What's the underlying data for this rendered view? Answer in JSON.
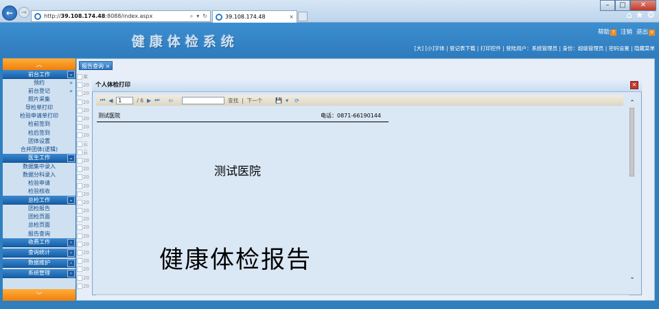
{
  "browser": {
    "url_prefix": "http://",
    "url_host": "39.108.174.48",
    "url_rest": ":8088/index.aspx",
    "tab_title": "39.108.174.48",
    "tab_close": "×",
    "back": "←",
    "forward": "→",
    "search_glyph": "⌕",
    "dropdown_glyph": "▾",
    "refresh_glyph": "↻",
    "home_glyph": "⌂",
    "star_glyph": "★",
    "gear_glyph": "⚙",
    "min": "–",
    "max": "□",
    "close": "✕"
  },
  "app": {
    "title": "健康体检系统",
    "help": "帮助",
    "help_icon": "?",
    "logout": "注销",
    "exit": "退出",
    "exit_icon": "×",
    "userbar": "[大] [小]字体 | 登记表下载 | 打印控件 | 登陆用户：系统管理员 | 身份：超级管理员 | 密码设置 | 隐藏菜单"
  },
  "sidebar": {
    "scroll_up": "︿",
    "scroll_down": "﹀",
    "sections": [
      {
        "label": "前台工作",
        "arrow": "⌄"
      },
      {
        "label": "医生工作",
        "arrow": "⌄"
      },
      {
        "label": "总检工作",
        "arrow": "⌄"
      },
      {
        "label": "收费工作",
        "arrow": "›"
      },
      {
        "label": "查询统计",
        "arrow": "›"
      },
      {
        "label": "数据维护",
        "arrow": "›"
      },
      {
        "label": "系统管理",
        "arrow": "›"
      }
    ],
    "front_items": [
      "预约",
      "前台登记",
      "照片采集",
      "导检单打印",
      "检验申请单打印",
      "检前签到",
      "检后签到",
      "团体设置",
      "合并团体(逻辑)"
    ],
    "front_chev": "»",
    "doctor_items": [
      "数据集中录入",
      "数据分科录入",
      "检验申请",
      "检验核收"
    ],
    "final_items": [
      "团检报告",
      "团检页面",
      "总检页面",
      "报告查询"
    ]
  },
  "content": {
    "tab_label": "报告查询",
    "tab_close": "×",
    "grid_rows": [
      "某",
      "20",
      "20",
      "20",
      "20",
      "20",
      "20",
      "20",
      "云",
      "云",
      "20",
      "20",
      "20",
      "20",
      "20",
      "20",
      "20",
      "20",
      "20",
      "20",
      "20",
      "20",
      "20",
      "20",
      "20",
      "20"
    ]
  },
  "dialog": {
    "title": "个人体检打印",
    "close": "✕",
    "toolbar": {
      "first": "⏮",
      "prev": "◀",
      "page": "1",
      "of": "/ 6",
      "next": "▶",
      "last": "⏭",
      "back": "⇦",
      "find": "查找",
      "sep": "|",
      "find_next": "下一个",
      "export": "💾",
      "export_arrow": "▾",
      "refresh": "⟳"
    },
    "report": {
      "hospital_small": "测试医院",
      "phone": "电话：0871-66190144",
      "hospital_large": "测试医院",
      "title": "健康体检报告"
    },
    "scroll_up": "⌃",
    "scroll_down": "⌄"
  }
}
